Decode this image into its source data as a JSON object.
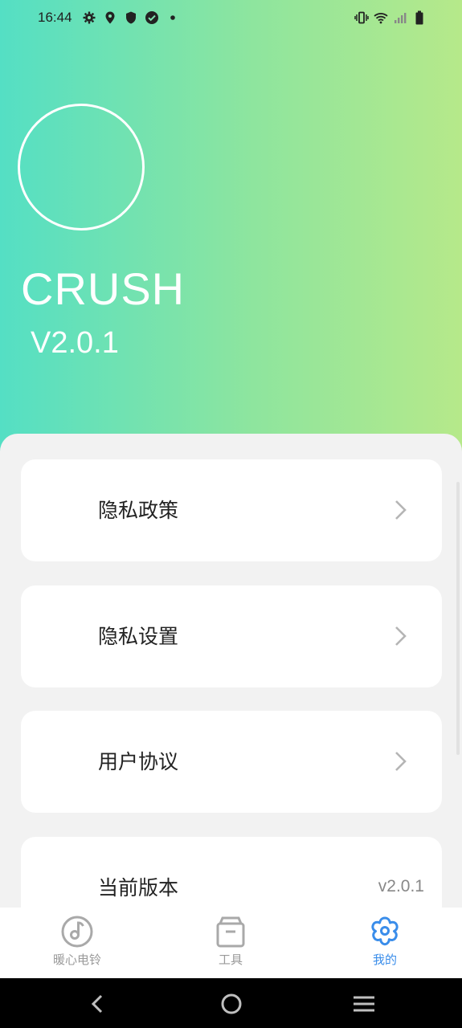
{
  "status_bar": {
    "time": "16:44"
  },
  "profile": {
    "app_name": "CRUSH",
    "version": "V2.0.1"
  },
  "menu": [
    {
      "label": "隐私政策"
    },
    {
      "label": "隐私设置"
    },
    {
      "label": "用户协议"
    },
    {
      "label": "当前版本",
      "value": "v2.0.1"
    }
  ],
  "tabs": [
    {
      "label": "暖心电铃",
      "icon": "music-note-icon"
    },
    {
      "label": "工具",
      "icon": "box-icon"
    },
    {
      "label": "我的",
      "icon": "flower-icon",
      "active": true
    }
  ],
  "colors": {
    "gradient_start": "#54dfc4",
    "gradient_end": "#b6e98a",
    "active_tab": "#3a8dea",
    "inactive_tab": "#9a9a9a"
  }
}
